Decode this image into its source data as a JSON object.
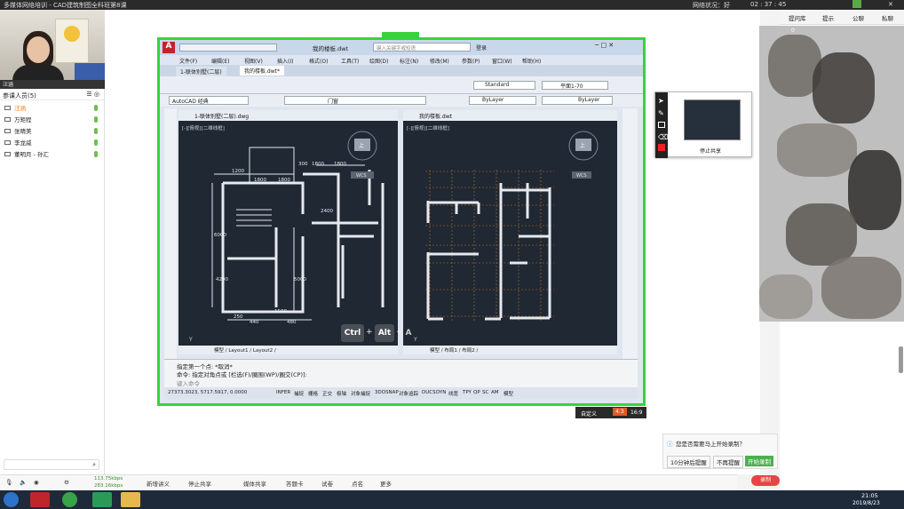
{
  "topbar": {
    "app_title": "多媒体网络培训 - CAD建筑制图全科班第8课",
    "net_status": "网络状况：好",
    "time": "02 : 37 : 45"
  },
  "left_panel": {
    "cam_label": "汪涵",
    "participants_header": "参课人员(5)",
    "participants": [
      "汪涵",
      "万矩程",
      "张晴美",
      "李龙威",
      "董明月 - 孙汇"
    ]
  },
  "acad": {
    "doc_title": "我的楼板.dwt",
    "search_placeholder": "键入关键字或短语",
    "login_label": "登录",
    "menus": [
      "文件(F)",
      "编辑(E)",
      "视图(V)",
      "插入(I)",
      "格式(O)",
      "工具(T)",
      "绘图(D)",
      "标注(N)",
      "修改(M)",
      "参数(P)",
      "窗口(W)",
      "帮助(H)"
    ],
    "file_tabs": [
      "1-联体别墅(二层)",
      "我的楼板.dwt*"
    ],
    "text_style": "Standard",
    "dim_style": "平面1-70",
    "workspace": "AutoCAD 经典",
    "layer": "门窗",
    "color": "ByLayer",
    "linetype": "ByLayer",
    "left_view": {
      "title": "1-联体别墅(二层).dwg",
      "label": "[-][俯视][二维线框]",
      "tabs": "模型 / Layout1 / Layout2 /",
      "dims": [
        "1200",
        "1800",
        "1800",
        "1800",
        "1800",
        "300",
        "2400",
        "6000",
        "4200",
        "5000",
        "250",
        "1500",
        "440",
        "480"
      ],
      "wcs": "WCS",
      "compass": "上"
    },
    "right_view": {
      "title": "我的楼板.dwt",
      "label": "[-][俯视][二维线框]",
      "tabs": "模型 / 布局1 / 布局2 /",
      "wcs": "WCS",
      "compass": "上"
    },
    "cmd_lines": [
      "指定第一个点: *取消*",
      "命令: 指定对角点或 [栏选(F)/圈围(WP)/圈交(CP)]:"
    ],
    "cmd_prompt": "键入命令",
    "coords": "27373.3023, 5717.5917, 0.0000",
    "status_items": [
      "INFER",
      "捕捉",
      "栅格",
      "正交",
      "极轴",
      "对象捕捉",
      "3DOSNAP",
      "对象追踪",
      "DUCS",
      "DYN",
      "线宽",
      "TPY",
      "QP",
      "SC",
      "AM",
      "模型"
    ]
  },
  "shortcut_keys": [
    "Ctrl",
    "+",
    "Alt",
    "+",
    "A"
  ],
  "float_box": {
    "caption": "停止共享"
  },
  "ratio_bar": {
    "custom_label": "自定义",
    "ratio_a": "4:3",
    "ratio_b": "16:9"
  },
  "invite": {
    "question": "您是否需要马上开始录制？",
    "btn_remind": "10分钟后提醒",
    "btn_no": "不再提醒",
    "btn_start": "开始录制"
  },
  "record_label": "录制",
  "bottombar": {
    "net_up": "113.75kbps",
    "net_down": "283.16kbps",
    "items": [
      "新增讲义",
      "停止共享",
      "媒体共享",
      "答题卡",
      "试卷",
      "点名",
      "更多"
    ]
  },
  "right_panel": {
    "tabs": [
      "提问库",
      "提示",
      "公聊",
      "私聊"
    ],
    "cam_count": "0"
  },
  "taskbar": {
    "time": "21:05",
    "date": "2019/8/23"
  },
  "colors": {
    "share_border": "#39d23c",
    "cad_bg": "#1f2833",
    "record": "#e64545",
    "active_participant": "#e77b1c"
  }
}
